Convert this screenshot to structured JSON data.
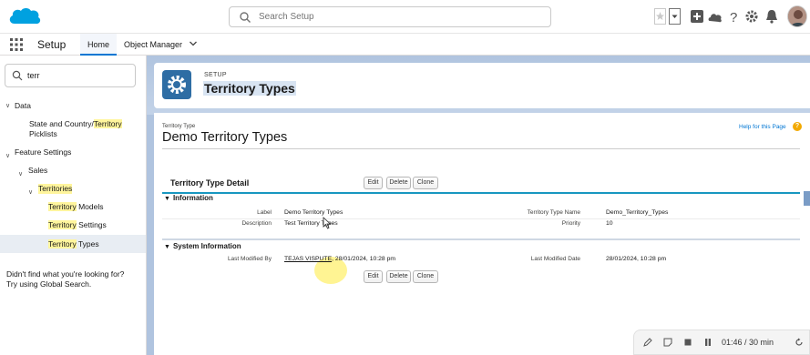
{
  "search": {
    "placeholder": "Search Setup"
  },
  "nav": {
    "app_name": "Setup",
    "tabs": [
      {
        "label": "Home"
      },
      {
        "label": "Object Manager"
      }
    ]
  },
  "sidebar": {
    "quick_find_value": "terr",
    "data_label": "Data",
    "state_country_prefix": "State and Country/",
    "state_country_match": "Territory",
    "state_country_suffix": "Picklists",
    "feature_settings_label": "Feature Settings",
    "sales_label": "Sales",
    "territories_label": "Territories",
    "territory_models_match": "Territory",
    "territory_models_rest": " Models",
    "territory_settings_match": "Territory",
    "territory_settings_rest": " Settings",
    "territory_types_match": "Territory",
    "territory_types_rest": " Types",
    "tip_line1": "Didn't find what you're looking for?",
    "tip_line2": "Try using Global Search."
  },
  "header": {
    "setup_label": "SETUP",
    "title": "Territory Types"
  },
  "record": {
    "type_label": "Territory Type",
    "title": "Demo Territory Types",
    "help_link": "Help for this Page",
    "help_icon": "?",
    "detail_title": "Territory Type Detail",
    "buttons": {
      "edit": "Edit",
      "delete": "Delete",
      "clone": "Clone"
    },
    "information_title": "Information",
    "system_info_title": "System Information",
    "fields": {
      "label_label": "Label",
      "label_value": "Demo Territory Types",
      "description_label": "Description",
      "description_value": "Test Territory Types",
      "api_name_label": "Territory Type Name",
      "api_name_value": "Demo_Territory_Types",
      "priority_label": "Priority",
      "priority_value": "10",
      "modified_by_label": "Last Modified By",
      "modified_by_user": "TEJAS VISPUTE",
      "modified_by_date": ", 28/01/2024, 10:28 pm",
      "modified_date_label": "Last Modified Date",
      "modified_date_value": "28/01/2024, 10:28 pm"
    }
  },
  "video": {
    "timer": "01:46 / 30 min"
  },
  "colors": {
    "brand_blue": "#0176d3",
    "setup_badge": "#2e6da4",
    "section_rule": "#1797c0",
    "highlight": "#fff59d"
  }
}
